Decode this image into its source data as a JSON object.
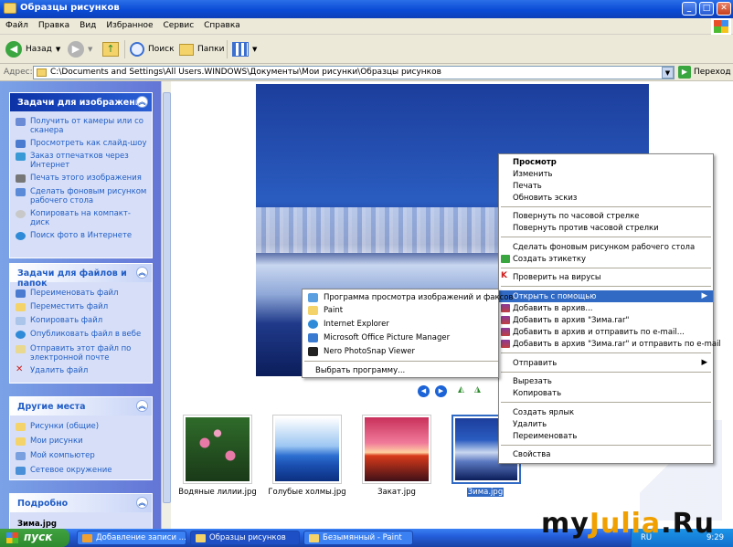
{
  "window": {
    "title": "Образцы рисунков",
    "controls": [
      "_",
      "□",
      "✕"
    ]
  },
  "menu": [
    "Файл",
    "Правка",
    "Вид",
    "Избранное",
    "Сервис",
    "Справка"
  ],
  "toolbar": {
    "back": "Назад",
    "search": "Поиск",
    "folders": "Папки"
  },
  "address": {
    "label": "Адрес:",
    "value": "C:\\Documents and Settings\\All Users.WINDOWS\\Документы\\Мои рисунки\\Образцы рисунков",
    "go": "Переход"
  },
  "panels": {
    "image_tasks": {
      "title": "Задачи для изображений",
      "items": [
        "Получить от камеры или со сканера",
        "Просмотреть как слайд-шоу",
        "Заказ отпечатков через Интернет",
        "Печать этого изображения",
        "Сделать фоновым рисунком рабочего стола",
        "Копировать на компакт-диск",
        "Поиск фото в Интернете"
      ]
    },
    "file_tasks": {
      "title": "Задачи для файлов и папок",
      "items": [
        "Переименовать файл",
        "Переместить файл",
        "Копировать файл",
        "Опубликовать файл в вебе",
        "Отправить этот файл по электронной почте",
        "Удалить файл"
      ]
    },
    "other_places": {
      "title": "Другие места",
      "items": [
        "Рисунки (общие)",
        "Мои рисунки",
        "Мой компьютер",
        "Сетевое окружение"
      ]
    },
    "details": {
      "title": "Подробно",
      "filename": "Зима.jpg"
    }
  },
  "thumbnails": [
    {
      "label": "Водяные лилии.jpg",
      "selected": false
    },
    {
      "label": "Голубые холмы.jpg",
      "selected": false
    },
    {
      "label": "Закат.jpg",
      "selected": false
    },
    {
      "label": "Зима.jpg",
      "selected": true
    }
  ],
  "context_menu": {
    "items": [
      "Просмотр",
      "Изменить",
      "Печать",
      "Обновить эскиз",
      "Повернуть по часовой стрелке",
      "Повернуть против часовой стрелки",
      "Сделать фоновым рисунком рабочего стола",
      "Создать этикетку",
      "Проверить на вирусы",
      "Открыть с помощью",
      "Добавить в архив...",
      "Добавить в архив \"Зима.rar\"",
      "Добавить в архив и отправить по e-mail...",
      "Добавить в архив \"Зима.rar\" и отправить по e-mail",
      "Отправить",
      "Вырезать",
      "Копировать",
      "Создать ярлык",
      "Удалить",
      "Переименовать",
      "Свойства"
    ],
    "highlighted": "Открыть с помощью"
  },
  "submenu": {
    "items": [
      "Программа просмотра изображений и факсов",
      "Paint",
      "Internet Explorer",
      "Microsoft Office Picture Manager",
      "Nero PhotoSnap Viewer",
      "Выбрать программу..."
    ]
  },
  "taskbar": {
    "start": "пуск",
    "buttons": [
      "Добавление записи ...",
      "Образцы рисунков",
      "Безымянный - Paint"
    ],
    "lang": "RU",
    "clock": "9:29"
  },
  "watermark": {
    "prefix": "my",
    "brand": "Julia",
    "suffix": ".Ru"
  },
  "colors": {
    "xp_blue": "#0a4bd6",
    "task_link": "#215dc6",
    "highlight": "#316ac5",
    "watermark_orange": "#f0a000"
  }
}
